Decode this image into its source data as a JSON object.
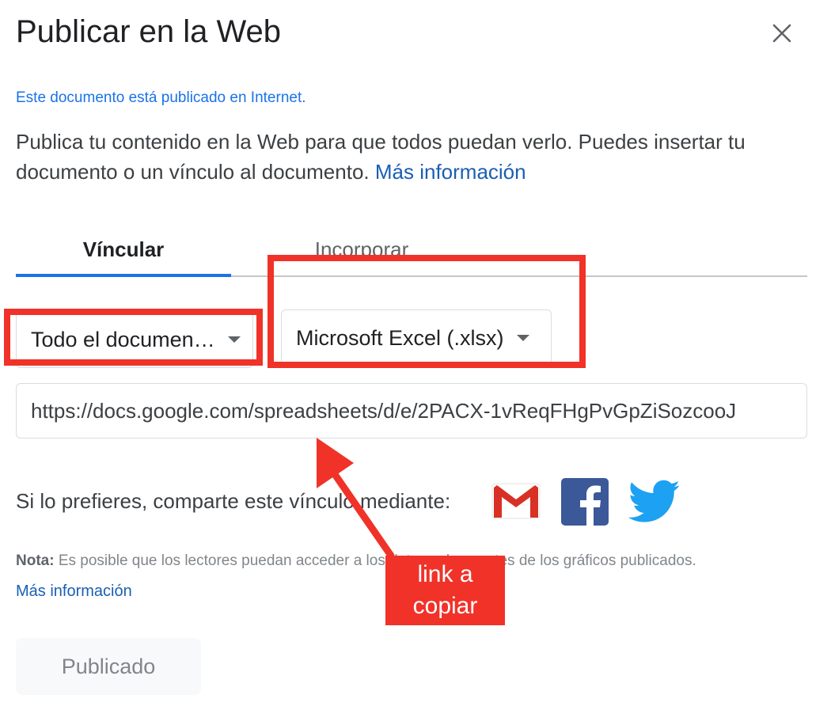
{
  "dialog": {
    "title": "Publicar en la Web",
    "status": "Este documento está publicado en Internet.",
    "description": "Publica tu contenido en la Web para que todos puedan verlo. Puedes insertar tu documento o un vínculo al documento.",
    "description_link": "Más información"
  },
  "tabs": [
    {
      "label": "Víncular",
      "active": true
    },
    {
      "label": "Incorporar",
      "active": false
    }
  ],
  "dropdowns": {
    "scope_selected": "Todo el documen…",
    "format_selected": "Microsoft Excel (.xlsx)"
  },
  "url_field": {
    "value": "https://docs.google.com/spreadsheets/d/e/2PACX-1vReqFHgPvGpZiSozcooJ"
  },
  "share": {
    "label": "Si lo prefieres, comparte este vínculo mediante:",
    "icons": [
      "gmail-icon",
      "facebook-icon",
      "twitter-icon"
    ]
  },
  "note": {
    "prefix": "Nota:",
    "text": "Es posible que los lectores puedan acceder a los datos subyacentes de los gráficos publicados.",
    "link": "Más información"
  },
  "publish_button": {
    "label": "Publicado"
  },
  "annotation": {
    "label_line1": "link a",
    "label_line2": "copiar",
    "color": "#f03229"
  },
  "colors": {
    "accent": "#1a73e8",
    "link": "#1a5fb4",
    "annotation_red": "#f03229"
  }
}
